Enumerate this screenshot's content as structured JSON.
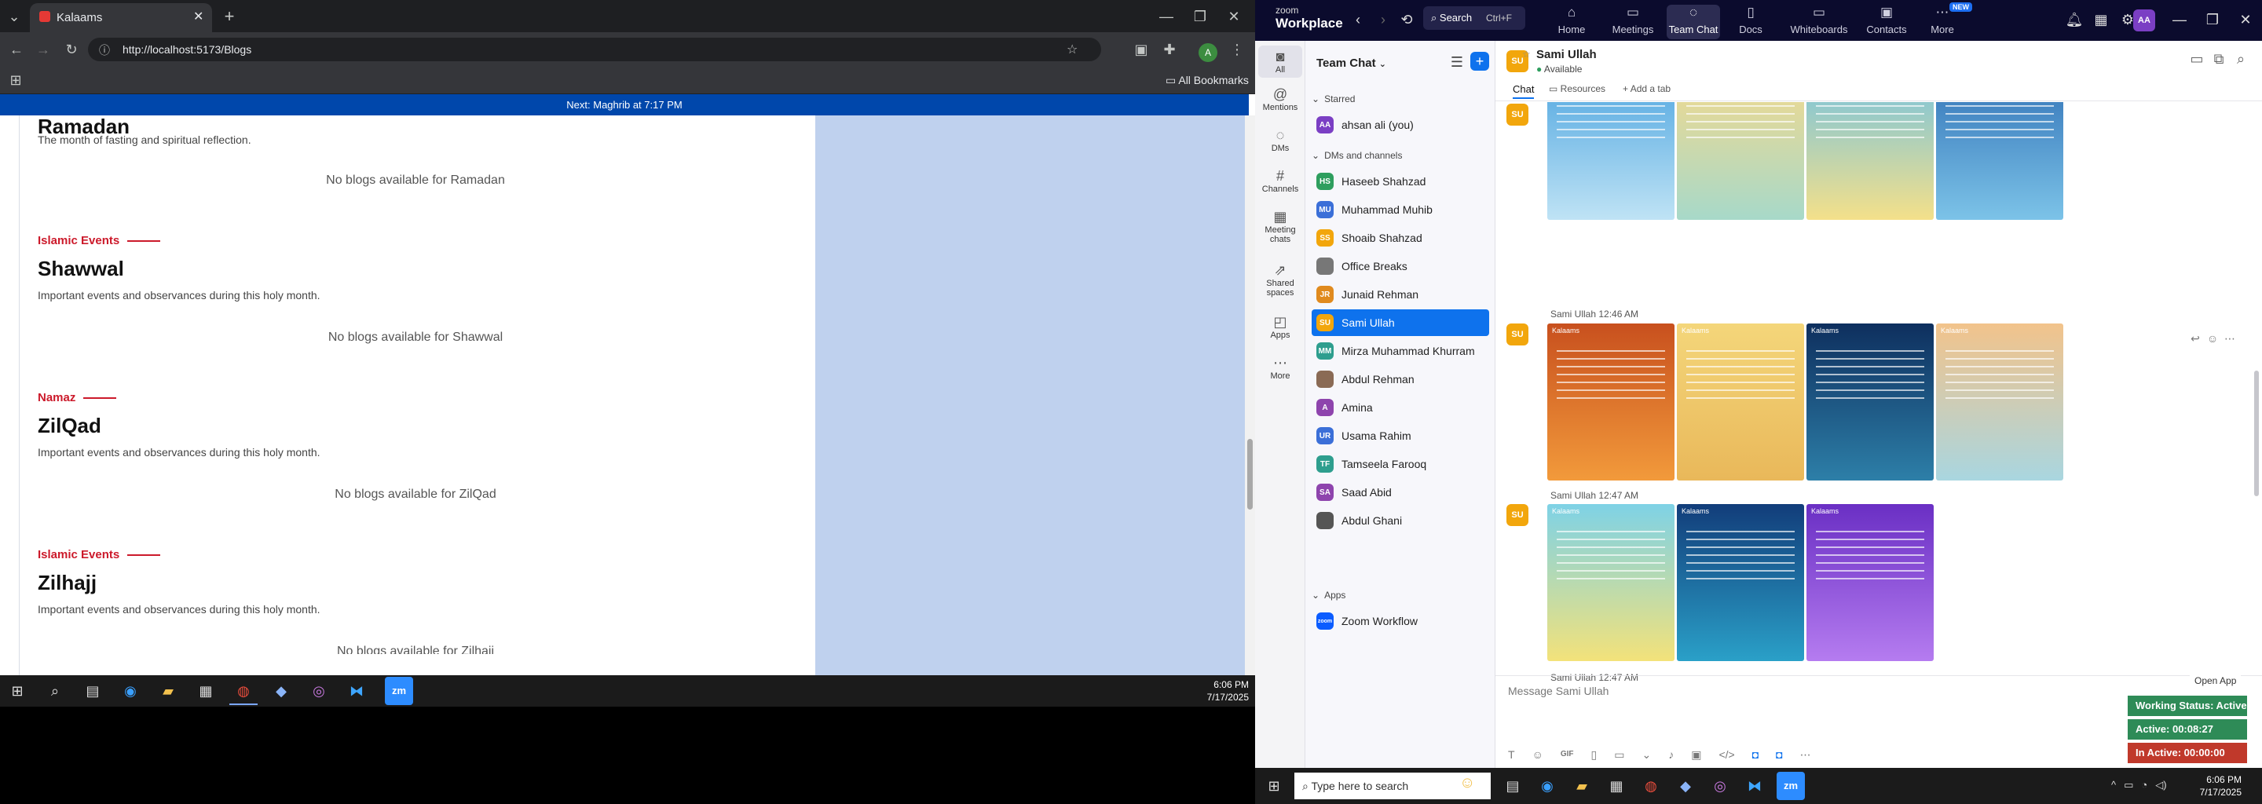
{
  "browser": {
    "tab_title": "Kalaams",
    "url": "http://localhost:5173/Blogs",
    "bookmarks_label": "All Bookmarks",
    "profile_initial": "A"
  },
  "page": {
    "banner": "Next: Maghrib at 7:17 PM",
    "top_section": {
      "name": "Ramadan",
      "desc": "The month of fasting and spiritual reflection.",
      "empty": "No blogs available for Ramadan"
    },
    "sections": [
      {
        "category": "Islamic Events",
        "name": "Shawwal",
        "desc": "Important events and observances during this holy month.",
        "empty": "No blogs available for Shawwal"
      },
      {
        "category": "Namaz",
        "name": "ZilQad",
        "desc": "Important events and observances during this holy month.",
        "empty": "No blogs available for ZilQad"
      },
      {
        "category": "Islamic Events",
        "name": "Zilhajj",
        "desc": "Important events and observances during this holy month.",
        "empty": "No blogs available for Zilhajj"
      }
    ]
  },
  "taskbar_left": {
    "time": "6:06 PM",
    "date": "7/17/2025"
  },
  "zoom": {
    "brand_top": "zoom",
    "brand_bottom": "Workplace",
    "search_label": "Search",
    "search_shortcut": "Ctrl+F",
    "tabs": [
      "Home",
      "Meetings",
      "Team Chat",
      "Docs",
      "Whiteboards",
      "Contacts",
      "More"
    ],
    "new_badge": "NEW",
    "user_initials": "AA",
    "rail": [
      "All",
      "Mentions",
      "DMs",
      "Channels",
      "Meeting chats",
      "Shared spaces",
      "Apps",
      "More"
    ],
    "list_title": "Team Chat",
    "sections": {
      "starred": "Starred",
      "dms": "DMs and channels",
      "apps": "Apps"
    },
    "starred": {
      "initials": "AA",
      "name": "ahsan ali (you)"
    },
    "contacts": [
      {
        "initials": "HS",
        "name": "Haseeb Shahzad",
        "color": "#2e9e5e"
      },
      {
        "initials": "MU",
        "name": "Muhammad Muhib",
        "color": "#3b6fd8"
      },
      {
        "initials": "SS",
        "name": "Shoaib Shahzad",
        "color": "#f2a60c"
      },
      {
        "initials": "",
        "name": "Office Breaks",
        "color": "#777777"
      },
      {
        "initials": "JR",
        "name": "Junaid Rehman",
        "color": "#e08a1e"
      },
      {
        "initials": "SU",
        "name": "Sami Ullah",
        "color": "#f2a60c"
      },
      {
        "initials": "MM",
        "name": "Mirza Muhammad Khurram",
        "color": "#2e9e8e"
      },
      {
        "initials": "",
        "name": "Abdul Rehman",
        "color": "#8a6a55"
      },
      {
        "initials": "A",
        "name": "Amina",
        "color": "#8e44ad"
      },
      {
        "initials": "UR",
        "name": "Usama Rahim",
        "color": "#3b6fd8"
      },
      {
        "initials": "TF",
        "name": "Tamseela Farooq",
        "color": "#2e9e8e"
      },
      {
        "initials": "SA",
        "name": "Saad Abid",
        "color": "#8e44ad"
      },
      {
        "initials": "",
        "name": "Abdul Ghani",
        "color": "#555555"
      }
    ],
    "apps": [
      {
        "name": "Zoom Workflow"
      }
    ],
    "chat_header": {
      "initials": "SU",
      "name": "Sami Ullah",
      "status": "Available"
    },
    "chat_tabs": [
      "Chat",
      "Resources",
      "Add a tab"
    ],
    "timestamps": [
      "Sami Ullah 12:46 AM",
      "Sami Ullah 12:47 AM",
      "Sami Ullah 12:47 AM"
    ],
    "tile_brand": "Kalaams",
    "composer_placeholder": "Message Sami Ullah",
    "open_app": "Open App",
    "status_working": "Working Status: Active",
    "status_active": "Active: 00:08:27",
    "status_inactive": "In Active: 00:00:00"
  },
  "taskbar_right": {
    "search_placeholder": "Type here to search",
    "time": "6:06 PM",
    "date": "7/17/2025"
  }
}
